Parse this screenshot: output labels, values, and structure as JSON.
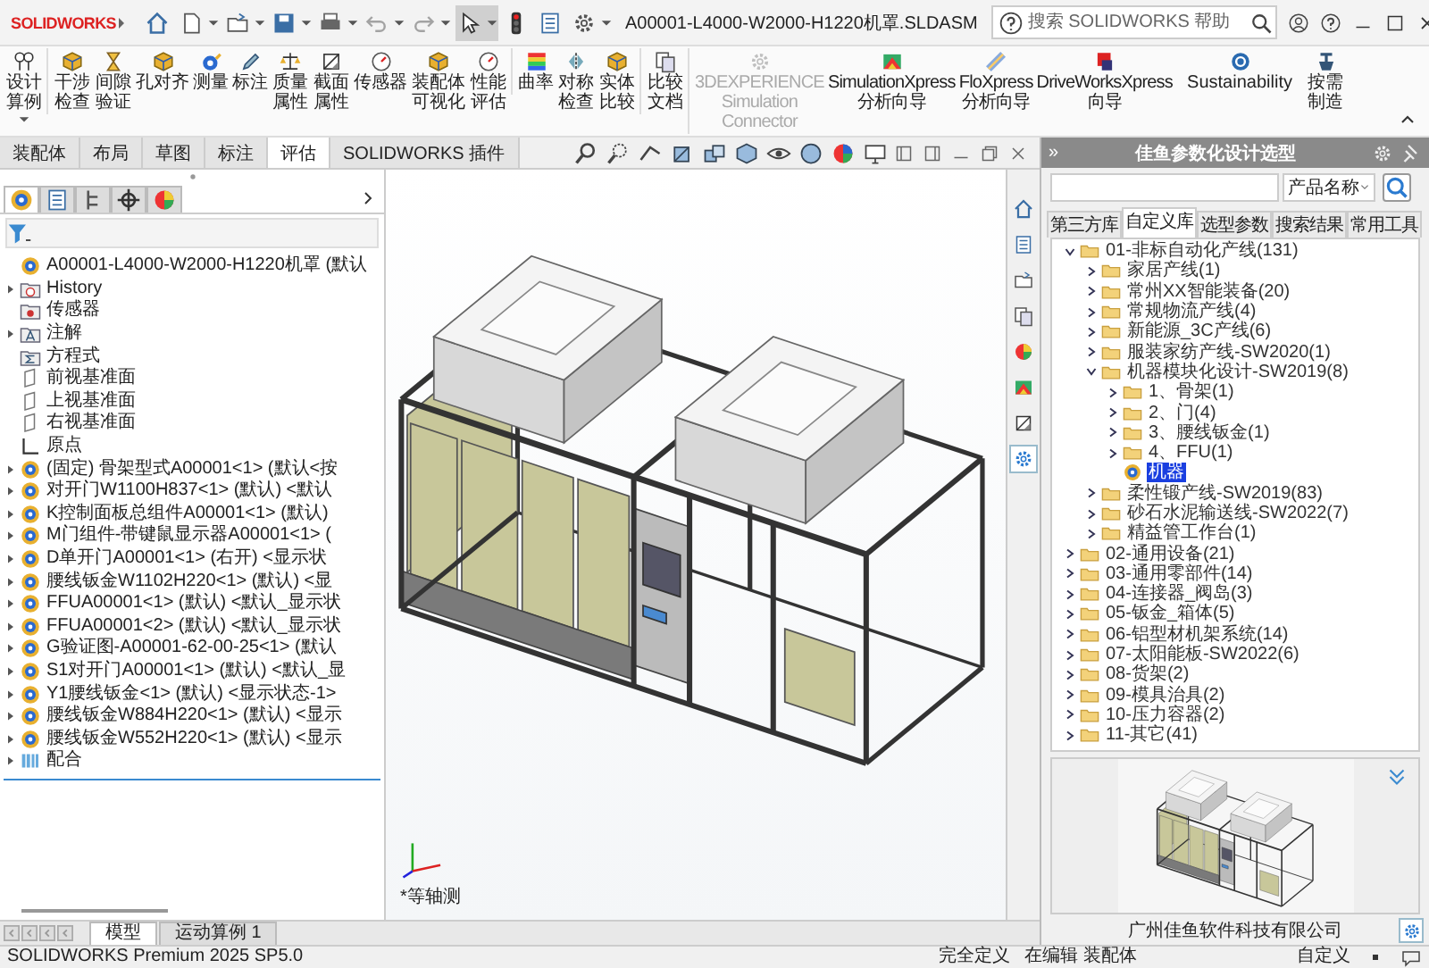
{
  "title_bar": {
    "app_name": "SOLIDWORKS",
    "title": "A00001-L4000-W2000-H1220机罩.SLDASM",
    "search": {
      "placeholder": "搜索 SOLIDWORKS 帮助"
    }
  },
  "quick_tools": [
    {
      "kind": "house",
      "disabled": false,
      "selected": false
    },
    {
      "kind": "page",
      "has_menu": true,
      "disabled": false,
      "selected": false
    },
    {
      "kind": "folder-arrow",
      "has_menu": true,
      "disabled": false,
      "selected": false
    },
    {
      "kind": "floppy",
      "has_menu": true,
      "disabled": false,
      "selected": false
    },
    {
      "kind": "printer",
      "has_menu": true,
      "disabled": false,
      "selected": false
    },
    {
      "kind": "undo-arrow",
      "has_menu": true,
      "disabled": true,
      "selected": false
    },
    {
      "kind": "redo-arrow",
      "has_menu": true,
      "disabled": true,
      "selected": false
    },
    {
      "kind": "pointer",
      "has_menu": true,
      "disabled": false,
      "selected": true
    },
    {
      "kind": "traffic-light",
      "disabled": false,
      "selected": false
    },
    {
      "kind": "list-page",
      "disabled": false,
      "selected": false
    },
    {
      "kind": "gear",
      "has_menu": true,
      "disabled": false,
      "selected": false
    }
  ],
  "ribbon": [
    {
      "label": "设计算例",
      "kind": "key-pair",
      "has_menu": true,
      "disabled": false,
      "group_start": false
    },
    {
      "label": "干涉检查",
      "kind": "cube",
      "has_menu": false,
      "disabled": false,
      "group_start": true
    },
    {
      "label": "间隙验证",
      "kind": "hourglass",
      "has_menu": false,
      "disabled": false,
      "group_start": false
    },
    {
      "label": "孔对齐",
      "kind": "cube",
      "has_menu": false,
      "disabled": false,
      "group_start": false
    },
    {
      "label": "测量",
      "kind": "tape-measure",
      "has_menu": false,
      "disabled": false,
      "group_start": false
    },
    {
      "label": "标注",
      "kind": "pencil",
      "has_menu": false,
      "disabled": false,
      "group_start": false
    },
    {
      "label": "质量属性",
      "kind": "scale",
      "has_menu": false,
      "disabled": false,
      "group_start": false
    },
    {
      "label": "截面属性",
      "kind": "section-square",
      "has_menu": false,
      "disabled": false,
      "group_start": false
    },
    {
      "label": "传感器",
      "kind": "gauge",
      "has_menu": false,
      "disabled": false,
      "group_start": false
    },
    {
      "label": "装配体可视化",
      "kind": "cube",
      "has_menu": false,
      "disabled": false,
      "group_start": false
    },
    {
      "label": "性能评估",
      "kind": "gauge",
      "has_menu": false,
      "disabled": false,
      "group_start": false
    },
    {
      "label": "曲率",
      "kind": "color-bands",
      "has_menu": false,
      "disabled": false,
      "group_start": true
    },
    {
      "label": "对称检查",
      "kind": "mirror",
      "has_menu": false,
      "disabled": false,
      "group_start": false
    },
    {
      "label": "实体比较",
      "kind": "cube",
      "has_menu": false,
      "disabled": false,
      "group_start": false
    },
    {
      "label": "比较文档",
      "kind": "two-pages",
      "has_menu": false,
      "disabled": false,
      "group_start": true
    },
    {
      "label": "3DEXPERIENCE Simulation Connector",
      "kind": "gear",
      "has_menu": false,
      "disabled": true,
      "group_start": true
    },
    {
      "label": "SimulationXpress 分析向导",
      "kind": "colored-plot",
      "has_menu": false,
      "disabled": false,
      "group_start": false
    },
    {
      "label": "FloXpress 分析向导",
      "kind": "pipe",
      "has_menu": false,
      "disabled": false,
      "group_start": false
    },
    {
      "label": "DriveWorksXpress 向导",
      "kind": "stacked-squares",
      "has_menu": false,
      "disabled": false,
      "group_start": false
    },
    {
      "label": "Sustainability",
      "kind": "ring",
      "has_menu": false,
      "disabled": false,
      "group_start": false
    },
    {
      "label": "按需制造",
      "kind": "valve",
      "has_menu": false,
      "disabled": false,
      "group_start": false
    }
  ],
  "command_tabs": [
    {
      "label": "装配体",
      "selected": false
    },
    {
      "label": "布局",
      "selected": false
    },
    {
      "label": "草图",
      "selected": false
    },
    {
      "label": "标注",
      "selected": false
    },
    {
      "label": "评估",
      "selected": true
    },
    {
      "label": "SOLIDWORKS 插件",
      "selected": false
    }
  ],
  "feature_tree": {
    "panel_tabs": [
      {
        "kind": "component",
        "selected": true
      },
      {
        "kind": "list-page",
        "selected": false
      },
      {
        "kind": "branch",
        "selected": false
      },
      {
        "kind": "crosshair",
        "selected": false
      },
      {
        "kind": "color-wheel",
        "selected": false
      }
    ],
    "root": "A00001-L4000-W2000-H1220机罩 (默认",
    "items": [
      {
        "label": "History",
        "kind": "history-folder",
        "expandable": true
      },
      {
        "label": "传感器",
        "kind": "sensor-folder",
        "expandable": false
      },
      {
        "label": "注解",
        "kind": "annotation-folder",
        "expandable": true
      },
      {
        "label": "方程式",
        "kind": "equation-folder",
        "expandable": false
      },
      {
        "label": "前视基准面",
        "kind": "plane",
        "expandable": false
      },
      {
        "label": "上视基准面",
        "kind": "plane",
        "expandable": false
      },
      {
        "label": "右视基准面",
        "kind": "plane",
        "expandable": false
      },
      {
        "label": "原点",
        "kind": "axes",
        "expandable": false
      },
      {
        "label": "(固定) 骨架型式A00001<1> (默认<按",
        "kind": "component",
        "expandable": true
      },
      {
        "label": "对开门W1100H837<1> (默认) <默认",
        "kind": "component",
        "expandable": true
      },
      {
        "label": "K控制面板总组件A00001<1> (默认)",
        "kind": "component",
        "expandable": true
      },
      {
        "label": "M门组件-带键鼠显示器A00001<1> (",
        "kind": "component",
        "expandable": true
      },
      {
        "label": "D单开门A00001<1> (右开) <显示状",
        "kind": "component",
        "expandable": true
      },
      {
        "label": "腰线钣金W1102H220<1> (默认) <显",
        "kind": "component",
        "expandable": true
      },
      {
        "label": "FFUA00001<1> (默认) <默认_显示状",
        "kind": "component",
        "expandable": true
      },
      {
        "label": "FFUA00001<2> (默认) <默认_显示状",
        "kind": "component",
        "expandable": true
      },
      {
        "label": "G验证图-A00001-62-00-25<1> (默认",
        "kind": "component",
        "expandable": true
      },
      {
        "label": "S1对开门A00001<1> (默认) <默认_显",
        "kind": "component",
        "expandable": true
      },
      {
        "label": "Y1腰线钣金<1> (默认) <显示状态-1>",
        "kind": "component",
        "expandable": true
      },
      {
        "label": "腰线钣金W884H220<1> (默认) <显示",
        "kind": "component",
        "expandable": true
      },
      {
        "label": "腰线钣金W552H220<1> (默认) <显示",
        "kind": "component",
        "expandable": true
      },
      {
        "label": "配合",
        "kind": "mate",
        "expandable": true
      }
    ]
  },
  "viewport": {
    "view_label": "*等轴测"
  },
  "side_tabs": [
    {
      "kind": "house",
      "selected": false
    },
    {
      "kind": "list-page",
      "selected": false
    },
    {
      "kind": "folder-arrow",
      "selected": false
    },
    {
      "kind": "two-pages",
      "selected": false
    },
    {
      "kind": "color-wheel",
      "selected": false
    },
    {
      "kind": "colored-plot",
      "selected": false
    },
    {
      "kind": "section-square",
      "selected": false
    },
    {
      "kind": "gear",
      "selected": true
    }
  ],
  "task_pane": {
    "collapse_glyph": "»",
    "title": "佳鱼参数化设计选型",
    "dropdown": "产品名称",
    "tabs": [
      {
        "label": "第三方库",
        "selected": false
      },
      {
        "label": "自定义库",
        "selected": true
      },
      {
        "label": "选型参数",
        "selected": false
      },
      {
        "label": "搜索结果",
        "selected": false
      },
      {
        "label": "常用工具",
        "selected": false
      }
    ],
    "tree": [
      {
        "label": "01-非标自动化产线(131)",
        "kind": "folder",
        "expanded": true,
        "selected": false,
        "children": [
          {
            "label": "家居产线(1)",
            "kind": "folder",
            "expanded": false,
            "selected": false
          },
          {
            "label": "常州XX智能装备(20)",
            "kind": "folder",
            "expanded": false,
            "selected": false
          },
          {
            "label": "常规物流产线(4)",
            "kind": "folder",
            "expanded": false,
            "selected": false
          },
          {
            "label": "新能源_3C产线(6)",
            "kind": "folder",
            "expanded": false,
            "selected": false
          },
          {
            "label": "服装家纺产线-SW2020(1)",
            "kind": "folder",
            "expanded": false,
            "selected": false
          },
          {
            "label": "机器模块化设计-SW2019(8)",
            "kind": "folder",
            "expanded": true,
            "selected": false,
            "children": [
              {
                "label": "1、骨架(1)",
                "kind": "folder",
                "expanded": false,
                "selected": false
              },
              {
                "label": "2、门(4)",
                "kind": "folder",
                "expanded": false,
                "selected": false
              },
              {
                "label": "3、腰线钣金(1)",
                "kind": "folder",
                "expanded": false,
                "selected": false
              },
              {
                "label": "4、FFU(1)",
                "kind": "folder",
                "expanded": false,
                "selected": false
              },
              {
                "label": "机器",
                "kind": "component",
                "selected": true
              }
            ]
          },
          {
            "label": "柔性锻产线-SW2019(83)",
            "kind": "folder",
            "expanded": false,
            "selected": false
          },
          {
            "label": "砂石水泥输送线-SW2022(7)",
            "kind": "folder",
            "expanded": false,
            "selected": false
          },
          {
            "label": "精益管工作台(1)",
            "kind": "folder",
            "expanded": false,
            "selected": false
          }
        ]
      },
      {
        "label": "02-通用设备(21)",
        "kind": "folder",
        "expanded": false,
        "selected": false
      },
      {
        "label": "03-通用零部件(14)",
        "kind": "folder",
        "expanded": false,
        "selected": false
      },
      {
        "label": "04-连接器_阀岛(3)",
        "kind": "folder",
        "expanded": false,
        "selected": false
      },
      {
        "label": "05-钣金_箱体(5)",
        "kind": "folder",
        "expanded": false,
        "selected": false
      },
      {
        "label": "06-铝型材机架系统(14)",
        "kind": "folder",
        "expanded": false,
        "selected": false
      },
      {
        "label": "07-太阳能板-SW2022(6)",
        "kind": "folder",
        "expanded": false,
        "selected": false
      },
      {
        "label": "08-货架(2)",
        "kind": "folder",
        "expanded": false,
        "selected": false
      },
      {
        "label": "09-模具治具(2)",
        "kind": "folder",
        "expanded": false,
        "selected": false
      },
      {
        "label": "10-压力容器(2)",
        "kind": "folder",
        "expanded": false,
        "selected": false
      },
      {
        "label": "11-其它(41)",
        "kind": "folder",
        "expanded": false,
        "selected": false
      }
    ],
    "company": "广州佳鱼软件科技有限公司"
  },
  "bottom_tabs": [
    {
      "label": "模型",
      "selected": true
    },
    {
      "label": "运动算例 1",
      "selected": false
    }
  ],
  "status_bar": {
    "product": "SOLIDWORKS Premium 2025 SP5.0",
    "state": "完全定义",
    "mode": "在编辑 装配体",
    "units": "自定义"
  }
}
